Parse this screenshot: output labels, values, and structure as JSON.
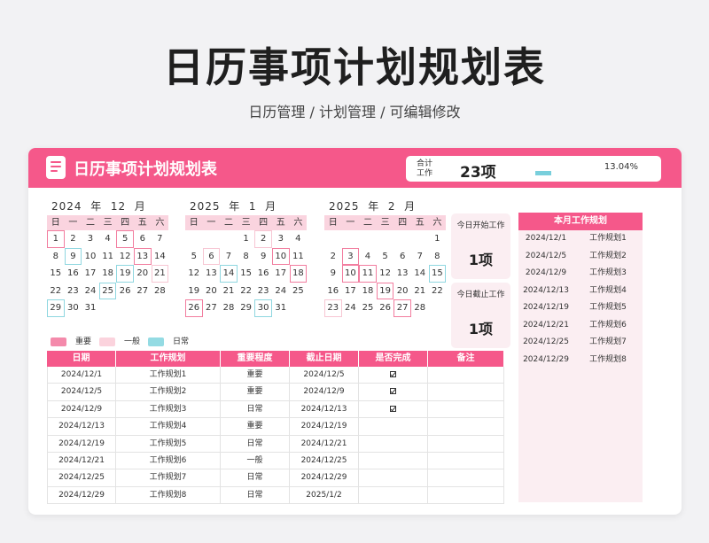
{
  "page": {
    "title": "日历事项计划规划表",
    "subtitle": "日历管理 / 计划管理 / 可编辑修改"
  },
  "header": {
    "title": "日历事项计划规划表",
    "stats_label": "合计工作",
    "stats_value": "23项",
    "progress_percent": 13.04,
    "progress_text": "13.04%"
  },
  "weekdays": [
    "日",
    "一",
    "二",
    "三",
    "四",
    "五",
    "六"
  ],
  "calendars": [
    {
      "year": "2024",
      "year_suffix": "年",
      "month": "12",
      "month_suffix": "月",
      "days": [
        {
          "n": "1",
          "t": "imp"
        },
        {
          "n": "2"
        },
        {
          "n": "3"
        },
        {
          "n": "4"
        },
        {
          "n": "5",
          "t": "imp"
        },
        {
          "n": "6"
        },
        {
          "n": "7"
        },
        {
          "n": "8"
        },
        {
          "n": "9",
          "t": "dly"
        },
        {
          "n": "10"
        },
        {
          "n": "11"
        },
        {
          "n": "12"
        },
        {
          "n": "13",
          "t": "imp"
        },
        {
          "n": "14"
        },
        {
          "n": "15"
        },
        {
          "n": "16"
        },
        {
          "n": "17"
        },
        {
          "n": "18"
        },
        {
          "n": "19",
          "t": "dly"
        },
        {
          "n": "20"
        },
        {
          "n": "21",
          "t": "gen"
        },
        {
          "n": "22"
        },
        {
          "n": "23"
        },
        {
          "n": "24"
        },
        {
          "n": "25",
          "t": "dly"
        },
        {
          "n": "26"
        },
        {
          "n": "27"
        },
        {
          "n": "28"
        },
        {
          "n": "29",
          "t": "dly"
        },
        {
          "n": "30"
        },
        {
          "n": "31"
        }
      ]
    },
    {
      "year": "2025",
      "year_suffix": "年",
      "month": "1",
      "month_suffix": "月",
      "days": [
        {
          "n": ""
        },
        {
          "n": ""
        },
        {
          "n": ""
        },
        {
          "n": "1"
        },
        {
          "n": "2",
          "t": "gen"
        },
        {
          "n": "3"
        },
        {
          "n": "4"
        },
        {
          "n": "5"
        },
        {
          "n": "6",
          "t": "gen"
        },
        {
          "n": "7"
        },
        {
          "n": "8"
        },
        {
          "n": "9"
        },
        {
          "n": "10",
          "t": "imp"
        },
        {
          "n": "11"
        },
        {
          "n": "12"
        },
        {
          "n": "13"
        },
        {
          "n": "14",
          "t": "dly"
        },
        {
          "n": "15"
        },
        {
          "n": "16"
        },
        {
          "n": "17"
        },
        {
          "n": "18",
          "t": "imp"
        },
        {
          "n": "19"
        },
        {
          "n": "20"
        },
        {
          "n": "21"
        },
        {
          "n": "22"
        },
        {
          "n": "23"
        },
        {
          "n": "24"
        },
        {
          "n": "25"
        },
        {
          "n": "26",
          "t": "imp"
        },
        {
          "n": "27"
        },
        {
          "n": "28"
        },
        {
          "n": "29"
        },
        {
          "n": "30",
          "t": "dly"
        },
        {
          "n": "31"
        }
      ]
    },
    {
      "year": "2025",
      "year_suffix": "年",
      "month": "2",
      "month_suffix": "月",
      "days": [
        {
          "n": ""
        },
        {
          "n": ""
        },
        {
          "n": ""
        },
        {
          "n": ""
        },
        {
          "n": ""
        },
        {
          "n": ""
        },
        {
          "n": "1"
        },
        {
          "n": "2"
        },
        {
          "n": "3",
          "t": "imp"
        },
        {
          "n": "4"
        },
        {
          "n": "5"
        },
        {
          "n": "6"
        },
        {
          "n": "7"
        },
        {
          "n": "8"
        },
        {
          "n": "9"
        },
        {
          "n": "10",
          "t": "imp"
        },
        {
          "n": "11",
          "t": "imp"
        },
        {
          "n": "12"
        },
        {
          "n": "13"
        },
        {
          "n": "14"
        },
        {
          "n": "15",
          "t": "dly"
        },
        {
          "n": "16"
        },
        {
          "n": "17"
        },
        {
          "n": "18"
        },
        {
          "n": "19",
          "t": "imp"
        },
        {
          "n": "20"
        },
        {
          "n": "21"
        },
        {
          "n": "22"
        },
        {
          "n": "23",
          "t": "gen"
        },
        {
          "n": "24"
        },
        {
          "n": "25"
        },
        {
          "n": "26"
        },
        {
          "n": "27",
          "t": "imp"
        },
        {
          "n": "28"
        }
      ]
    }
  ],
  "today_start": {
    "label": "今日开始工作",
    "value": "1项"
  },
  "today_end": {
    "label": "今日截止工作",
    "value": "1项"
  },
  "monthly_plan": {
    "title": "本月工作规划",
    "rows": [
      {
        "date": "2024/12/1",
        "name": "工作规划1"
      },
      {
        "date": "2024/12/5",
        "name": "工作规划2"
      },
      {
        "date": "2024/12/9",
        "name": "工作规划3"
      },
      {
        "date": "2024/12/13",
        "name": "工作规划4"
      },
      {
        "date": "2024/12/19",
        "name": "工作规划5"
      },
      {
        "date": "2024/12/21",
        "name": "工作规划6"
      },
      {
        "date": "2024/12/25",
        "name": "工作规划7"
      },
      {
        "date": "2024/12/29",
        "name": "工作规划8"
      }
    ]
  },
  "legend": [
    {
      "label": "重要",
      "color": "#f48aab"
    },
    {
      "label": "一般",
      "color": "#fbd3dd"
    },
    {
      "label": "日常",
      "color": "#94dbe3"
    }
  ],
  "table": {
    "headers": [
      "日期",
      "工作规划",
      "重要程度",
      "截止日期",
      "是否完成",
      "备注"
    ],
    "rows": [
      {
        "date": "2024/12/1",
        "plan": "工作规划1",
        "level": "重要",
        "deadline": "2024/12/5",
        "done": true,
        "note": ""
      },
      {
        "date": "2024/12/5",
        "plan": "工作规划2",
        "level": "重要",
        "deadline": "2024/12/9",
        "done": true,
        "note": ""
      },
      {
        "date": "2024/12/9",
        "plan": "工作规划3",
        "level": "日常",
        "deadline": "2024/12/13",
        "done": true,
        "note": ""
      },
      {
        "date": "2024/12/13",
        "plan": "工作规划4",
        "level": "重要",
        "deadline": "2024/12/19",
        "done": false,
        "note": ""
      },
      {
        "date": "2024/12/19",
        "plan": "工作规划5",
        "level": "日常",
        "deadline": "2024/12/21",
        "done": false,
        "note": ""
      },
      {
        "date": "2024/12/21",
        "plan": "工作规划6",
        "level": "一般",
        "deadline": "2024/12/25",
        "done": false,
        "note": ""
      },
      {
        "date": "2024/12/25",
        "plan": "工作规划7",
        "level": "日常",
        "deadline": "2024/12/29",
        "done": false,
        "note": ""
      },
      {
        "date": "2024/12/29",
        "plan": "工作规划8",
        "level": "日常",
        "deadline": "2025/1/2",
        "done": false,
        "note": ""
      }
    ]
  },
  "colors": {
    "accent": "#f5588a",
    "light_pink": "#fad4df",
    "panel_pink": "#fbeef2",
    "progress": "#79cfdc"
  }
}
